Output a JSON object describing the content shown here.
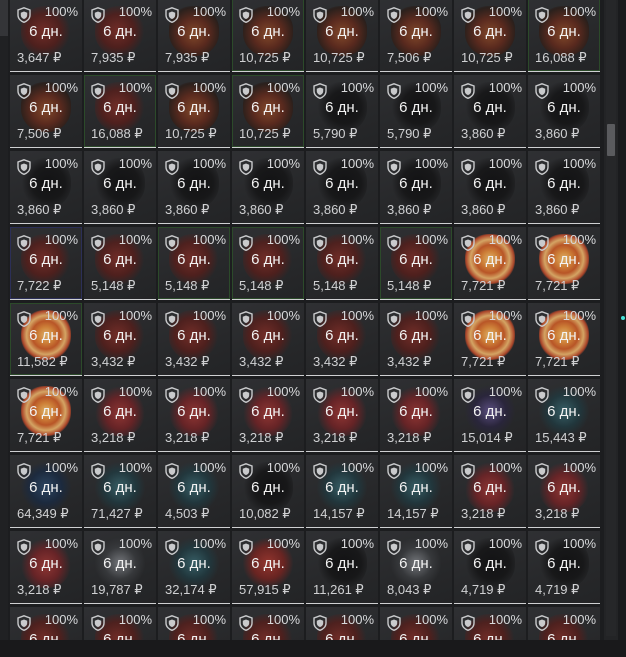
{
  "grid": {
    "days_label": "6 дн.",
    "percent_label": "100%",
    "currency": "₽",
    "rows": [
      [
        "",
        "",
        "",
        "",
        "",
        "",
        "",
        ""
      ],
      [
        "3,647",
        "7,935",
        "7,935",
        "10,725",
        "10,725",
        "7,506",
        "10,725",
        "16,088"
      ],
      [
        "7,506",
        "16,088",
        "10,725",
        "10,725",
        "5,790",
        "5,790",
        "3,860",
        "3,860"
      ],
      [
        "3,860",
        "3,860",
        "3,860",
        "3,860",
        "3,860",
        "3,860",
        "3,860",
        "3,860"
      ],
      [
        "7,722",
        "5,148",
        "5,148",
        "5,148",
        "5,148",
        "5,148",
        "7,721",
        "7,721"
      ],
      [
        "11,582",
        "3,432",
        "3,432",
        "3,432",
        "3,432",
        "3,432",
        "7,721",
        "7,721"
      ],
      [
        "7,721",
        "3,218",
        "3,218",
        "3,218",
        "3,218",
        "3,218",
        "15,014",
        "15,443"
      ],
      [
        "64,349",
        "71,427",
        "4,503",
        "10,082",
        "14,157",
        "14,157",
        "3,218",
        "3,218"
      ],
      [
        "3,218",
        "19,787",
        "32,174",
        "57,915",
        "11,261",
        "8,043",
        "4,719",
        "4,719"
      ],
      [
        "",
        "",
        "",
        "",
        "",
        "",
        "",
        ""
      ]
    ],
    "art": [
      [
        "red",
        "red",
        "red",
        "fire",
        "fire",
        "red",
        "fire",
        "fire"
      ],
      [
        "red",
        "red",
        "fire",
        "fire",
        "fire",
        "fire",
        "fire",
        "fire"
      ],
      [
        "fire",
        "red",
        "fire",
        "fire",
        "dark",
        "dark",
        "dark",
        "dark"
      ],
      [
        "dark",
        "dark",
        "dark",
        "dark",
        "dark",
        "dark",
        "dark",
        "dark"
      ],
      [
        "red",
        "red",
        "red",
        "red",
        "red",
        "red",
        "swirl",
        "swirl"
      ],
      [
        "swirl",
        "red",
        "red",
        "red",
        "red",
        "red",
        "swirl",
        "swirl"
      ],
      [
        "swirl",
        "horn",
        "horn",
        "horn",
        "horn",
        "horn",
        "purple",
        "teal"
      ],
      [
        "blue",
        "teal",
        "teal",
        "dark",
        "teal",
        "teal",
        "horn",
        "horn"
      ],
      [
        "horn",
        "white",
        "teal",
        "redbig",
        "dark",
        "white",
        "dark",
        "dark"
      ],
      [
        "red",
        "red",
        "red",
        "red",
        "red",
        "red",
        "red",
        "red"
      ]
    ],
    "border": [
      [
        "",
        "",
        "",
        "",
        "",
        "",
        "",
        ""
      ],
      [
        "",
        "",
        "",
        "g",
        "",
        "",
        "",
        "g"
      ],
      [
        "",
        "g",
        "",
        "g",
        "",
        "",
        "",
        ""
      ],
      [
        "",
        "",
        "",
        "",
        "",
        "",
        "",
        ""
      ],
      [
        "b",
        "",
        "g",
        "g",
        "",
        "g",
        "",
        ""
      ],
      [
        "g",
        "",
        "",
        "",
        "",
        "",
        "",
        ""
      ],
      [
        "",
        "",
        "",
        "",
        "",
        "",
        "",
        ""
      ],
      [
        "",
        "",
        "",
        "",
        "",
        "",
        "",
        ""
      ],
      [
        "",
        "",
        "",
        "",
        "",
        "",
        "",
        ""
      ],
      [
        "",
        "",
        "",
        "",
        "",
        "",
        "",
        ""
      ]
    ]
  },
  "colors": {
    "accent_cyan": "#46e0d8",
    "cell_bg": "#2a2b2d",
    "underline": "#cfd0d2"
  },
  "icons": {
    "protection": "shield-icon"
  }
}
